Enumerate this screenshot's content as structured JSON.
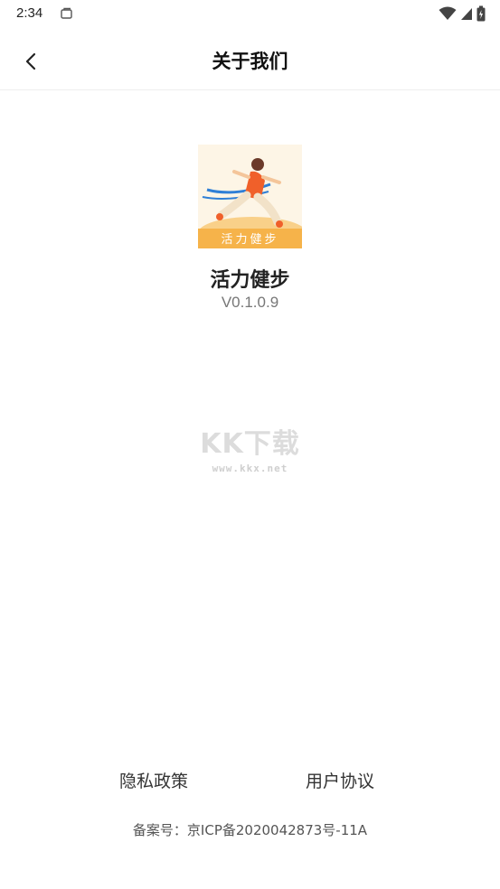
{
  "status_bar": {
    "time": "2:34",
    "icons": [
      "notification-icon",
      "wifi-icon",
      "signal-icon",
      "battery-icon"
    ]
  },
  "header": {
    "back_icon": "chevron-left-icon",
    "title": "关于我们"
  },
  "app": {
    "logo_text": "活力健步",
    "name": "活力健步",
    "version": "V0.1.0.9"
  },
  "watermark": {
    "main": "KK下载",
    "sub": "www.kkx.net"
  },
  "footer": {
    "privacy_label": "隐私政策",
    "agreement_label": "用户协议",
    "icp": "备案号：京ICP备2020042873号-11A"
  },
  "colors": {
    "logo_band": "#f6b34a",
    "logo_bg": "#fdf5e6",
    "runner_shirt": "#f0602a",
    "ribbon": "#2f7fd6"
  }
}
